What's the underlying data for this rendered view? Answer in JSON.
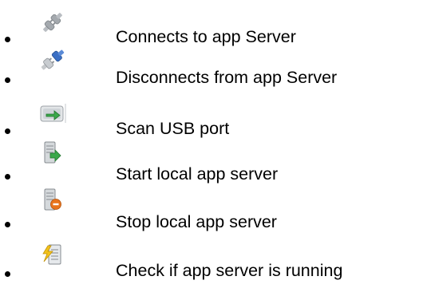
{
  "legend": {
    "items": [
      {
        "icon": "plug-connect-icon",
        "label": "Connects to app Server"
      },
      {
        "icon": "plug-disconnect-icon",
        "label": "Disconnects from app Server"
      },
      {
        "icon": "usb-scan-icon",
        "label": "Scan USB port"
      },
      {
        "icon": "server-start-icon",
        "label": "Start local app server"
      },
      {
        "icon": "server-stop-icon",
        "label": "Stop local app server"
      },
      {
        "icon": "server-check-icon",
        "label": "Check if app server is running"
      }
    ]
  },
  "colors": {
    "text": "#000000",
    "background": "#ffffff",
    "plug_grey": "#9ea3a8",
    "plug_blue": "#3a6fc4",
    "arrow_green": "#3aa84a",
    "stop_orange": "#e8741c",
    "bolt_yellow": "#f2c21b"
  }
}
